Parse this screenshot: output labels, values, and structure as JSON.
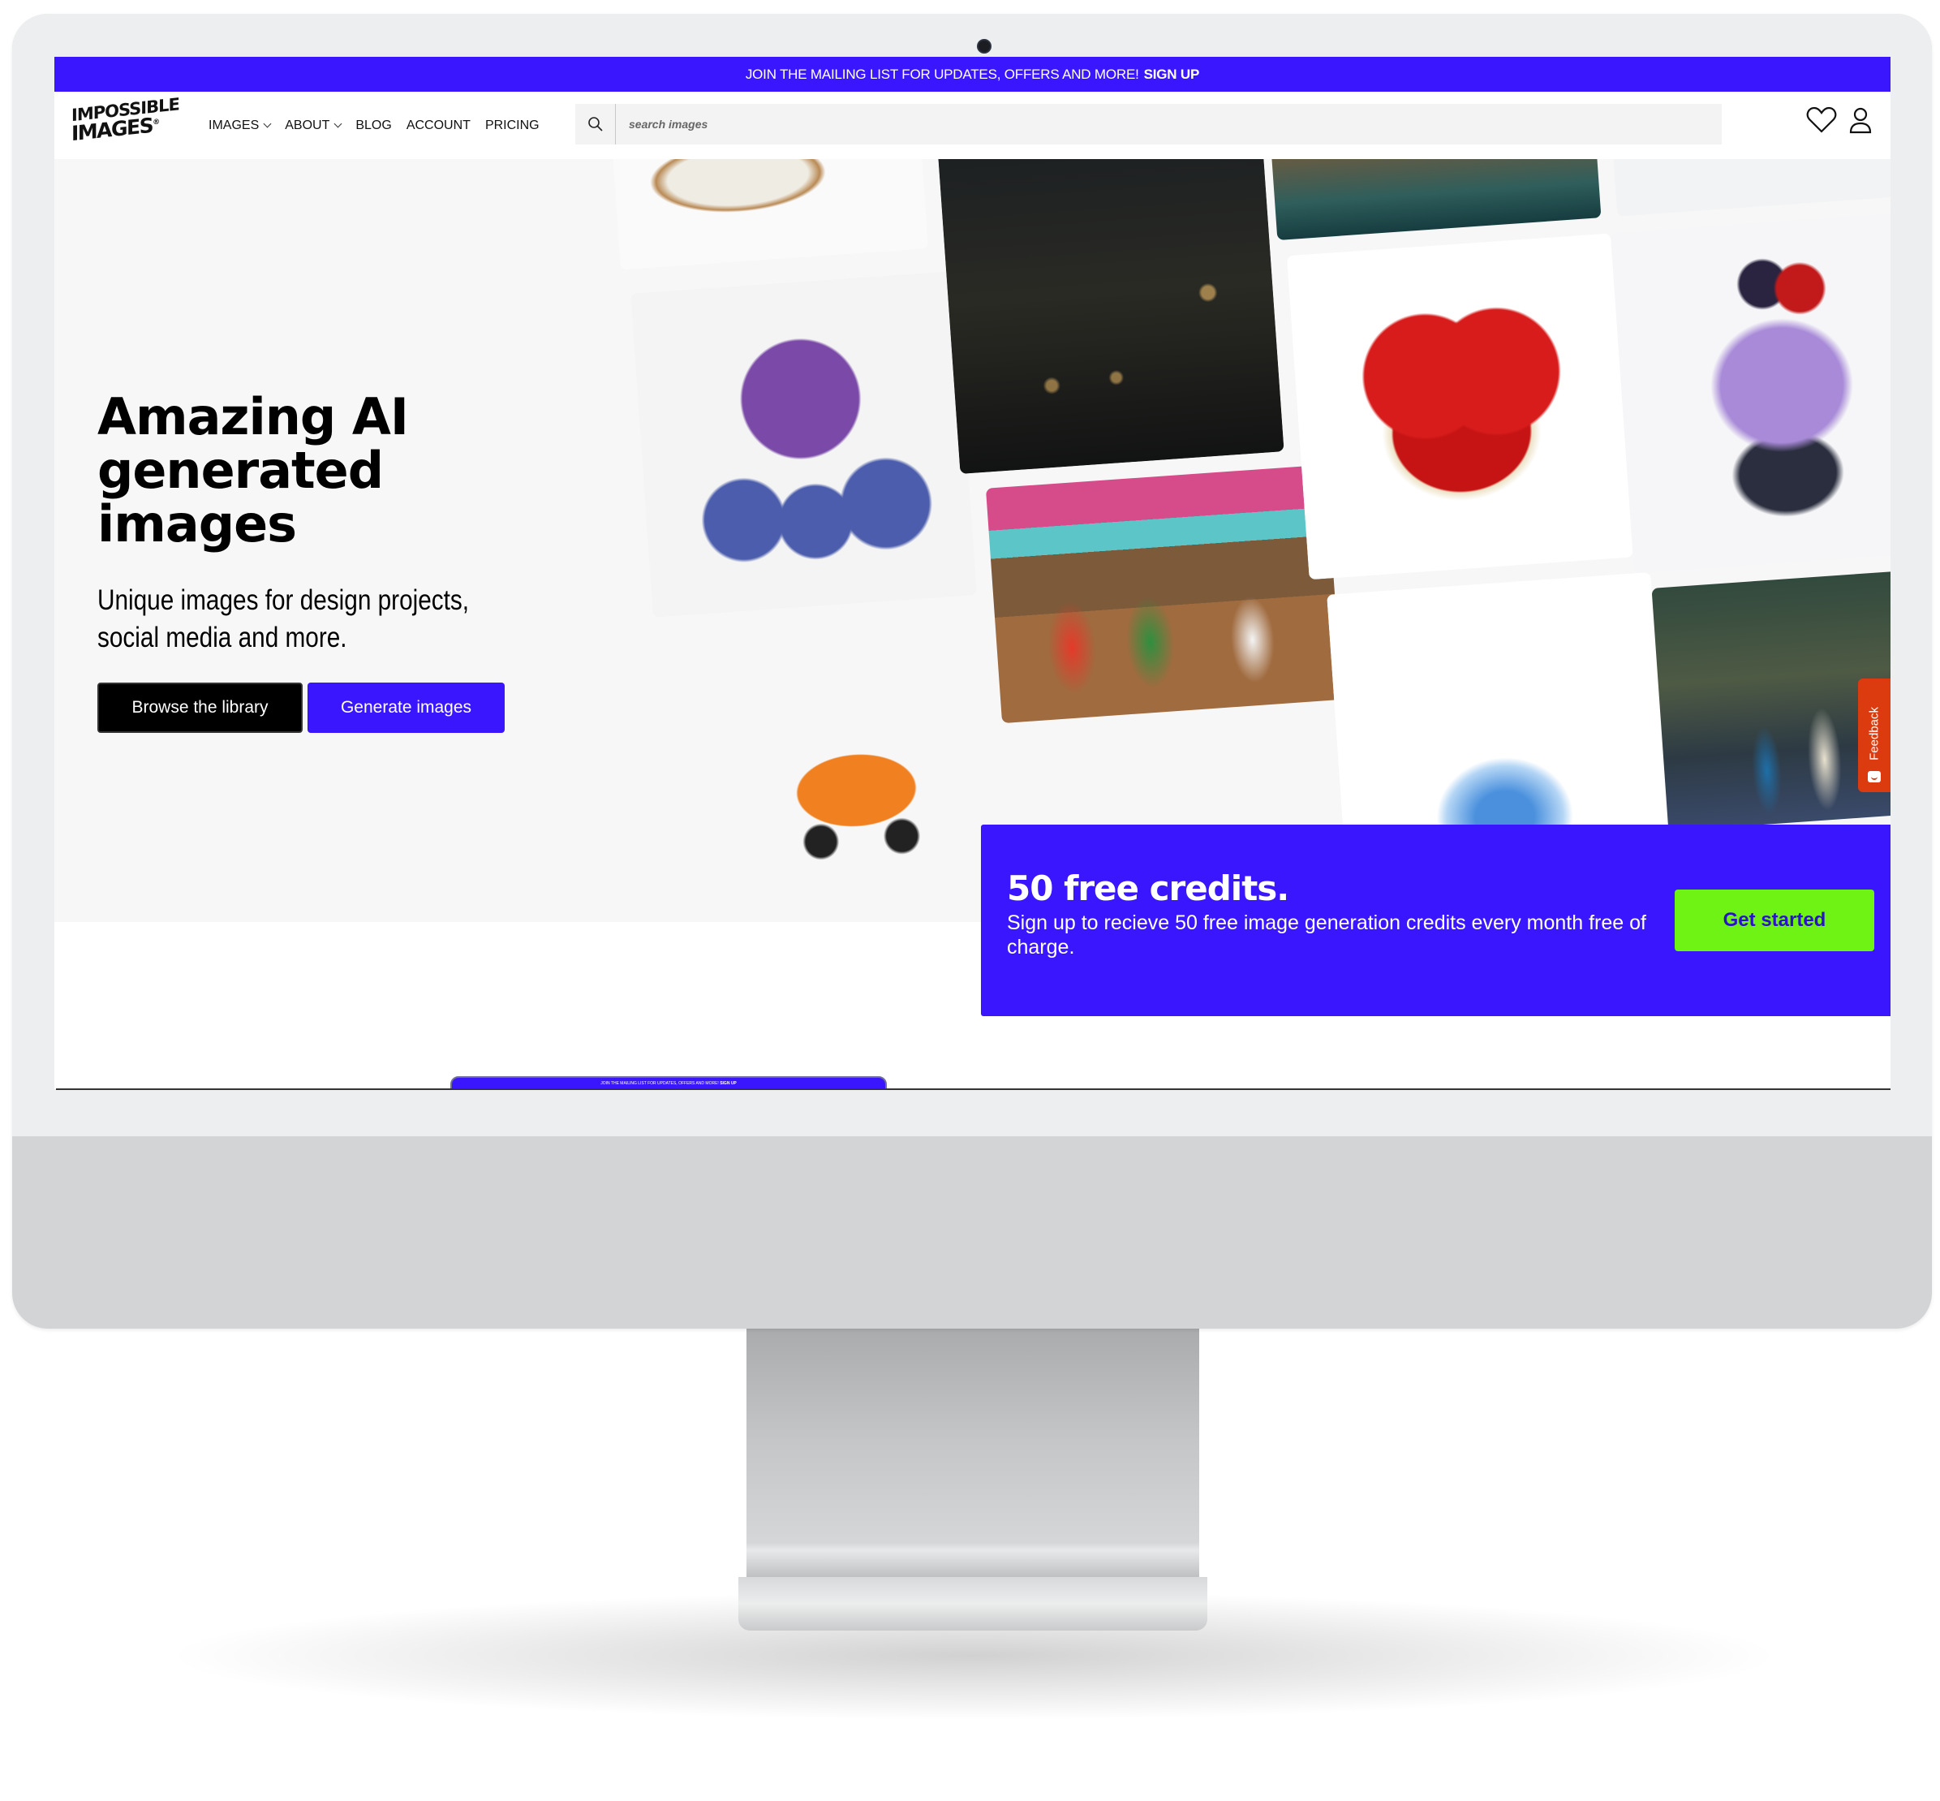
{
  "announcement": {
    "text": "JOIN THE MAILING LIST FOR UPDATES, OFFERS AND MORE!",
    "link": "SIGN UP"
  },
  "nav": {
    "logo_line1": "IMPOSSIBLE",
    "logo_line2": "IMAGES",
    "logo_mark": "®",
    "items": [
      {
        "label": "IMAGES",
        "dropdown": true
      },
      {
        "label": "ABOUT",
        "dropdown": true
      },
      {
        "label": "BLOG",
        "dropdown": false
      },
      {
        "label": "ACCOUNT",
        "dropdown": false
      },
      {
        "label": "PRICING",
        "dropdown": false
      }
    ],
    "search_placeholder": "search images",
    "icons": [
      "search-icon",
      "heart-icon",
      "user-icon"
    ]
  },
  "hero": {
    "title_line1": "Amazing AI",
    "title_line2": "generated images",
    "subtitle": "Unique images for design projects, social media and more.",
    "primary_button": "Browse the library",
    "secondary_button": "Generate images",
    "tiles": [
      "toast",
      "purple monsters",
      "orange car",
      "gothic library",
      "fiesta dancers",
      "fantasy city",
      "heart strawberry cheesecake",
      "blue crystal",
      "red monster",
      "berry dessert",
      "supermarket scene"
    ]
  },
  "feedback": {
    "label": "Feedback",
    "icon": "smile-chat-icon"
  },
  "promo": {
    "title": "50 free credits.",
    "text": "Sign up to recieve 50 free image generation credits every month free of charge.",
    "button": "Get started"
  },
  "mini_announcement": {
    "text": "JOIN THE MAILING LIST FOR UPDATES, OFFERS AND MORE!",
    "link": "SIGN UP"
  },
  "colors": {
    "brand_blue": "#3a16ff",
    "cta_green": "#6ef315",
    "feedback_orange": "#db3b0e"
  }
}
